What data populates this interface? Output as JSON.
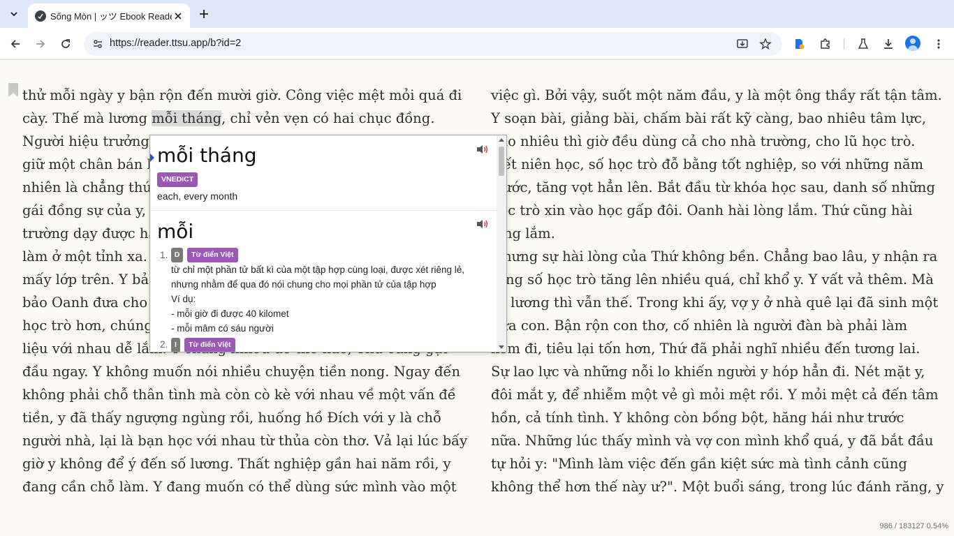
{
  "browser": {
    "tab_title": "Sống Mòn | ッツ Ebook Reader",
    "url": "https://reader.ttsu.app/b?id=2"
  },
  "reader": {
    "left_column": [
      "thử mỗi ngày y bận rộn đến mười giờ. Công việc mệt mỏi quá đi",
      [
        "cày. Thế mà lương ",
        "mỗi tháng",
        ", chỉ vẻn vẹn có hai chục đồng."
      ],
      "Người hiệu trưởng",
      "giữ một chân bán l",
      "nhiên là chẳng thứ",
      "gái đồng sự của y, n",
      "trường dạy được ha",
      "làm ở một tỉnh xa.",
      "mấy lớp trên. Y bảo",
      "bảo Oanh đưa cho",
      "học trò hơn, chúng",
      "liệu với nhau dễ lắm. Y chẳng nhiều để thế nào, Thứ cũng gật",
      "đầu ngay. Y không muốn nói nhiều chuyện tiền nong. Ngay đến",
      "không phải chỗ thân tình mà còn cò kè với nhau về một vấn đề",
      "tiền, y đã thấy ngượng ngùng rồi, huống hồ Đích với y là chỗ",
      "người nhà, lại là bạn học với nhau từ thủa còn thơ. Vả lại lúc bấy",
      "giờ y không để ý đến số lương. Thất nghiệp gần hai năm rồi, y",
      "đang cần chỗ làm. Y đang muốn có thể dùng sức mình vào một"
    ],
    "right_column": [
      "việc gì. Bởi vậy, suốt một năm đầu, y là một ông thầy rất tận tâm.",
      "Y soạn bài, giảng bài, chấm bài rất kỹ càng, bao nhiêu tâm lực,",
      "bao nhiêu thì giờ đều dùng cả cho nhà trường, cho lũ học trò.",
      "Hết niên học, số học trò đỗ bằng tốt nghiệp, so với những năm",
      "trước, tăng vọt hẳn lên. Bắt đầu từ khóa học sau, danh số những",
      "học trò xin vào học gấp đôi. Oanh hài lòng lắm. Thứ cũng hài",
      "lòng lắm.",
      "Nhưng sự hài lòng của Thứ không bền. Chẳng bao lâu, y nhận ra",
      "rằng số học trò tăng lên nhiều quá, chỉ khổ y. Y vất vả thêm. Mà",
      "số lương thì vẫn thế. Trong khi ấy, vợ y ở nhà quê lại đã sinh một",
      "đứa con. Bận rộn con thơ, cố nhiên là người đàn bà phải làm",
      "kém đi, tiêu lại tốn hơn, Thứ đã phải nghĩ nhiều đến tương lai.",
      "Sự lao lực và những nỗi lo khiến người y hóp hẳn đi. Nét mặt y,",
      "đôi mắt y, để nhiễm một vẻ gì mỏi mệt rồi. Y mỏi mệt cả đến tâm",
      "hồn, cả tính tình. Y không còn bồng bột, hăng hái như trước",
      "nữa. Những lúc thấy mình và vợ con mình khổ quá, y đã bắt đầu",
      "tự hỏi y: \"Mình làm việc đến gần kiệt sức mà tình cảnh cũng",
      "không thể hơn thế này ư?\". Một buổi sáng, trong lúc đánh răng, y"
    ],
    "status": "986 / 183127 0.54%"
  },
  "popup": {
    "entry1": {
      "term": "mỗi tháng",
      "dict": "VNEDICT",
      "gloss": "each, every month"
    },
    "entry2": {
      "term": "mỗi",
      "sense1": {
        "num": "1.",
        "pos": "D",
        "dict": "Từ điển Việt",
        "lines": [
          "từ chỉ một phần tử bất kì của một tập hợp cùng loại, được xét riêng lẻ,",
          "nhưng nhằm để qua đó nói chung cho mọi phần tử của tập hợp",
          "Ví dụ:",
          "- mỗi giờ đi được 40 kilomet",
          "- mỗi mâm có sáu người"
        ]
      },
      "sense2": {
        "num": "2.",
        "pos": "I",
        "dict": "Từ điển Việt"
      }
    }
  },
  "icons": {
    "tab_search": "chevron-down-icon",
    "speaker": "speaker-icon"
  }
}
